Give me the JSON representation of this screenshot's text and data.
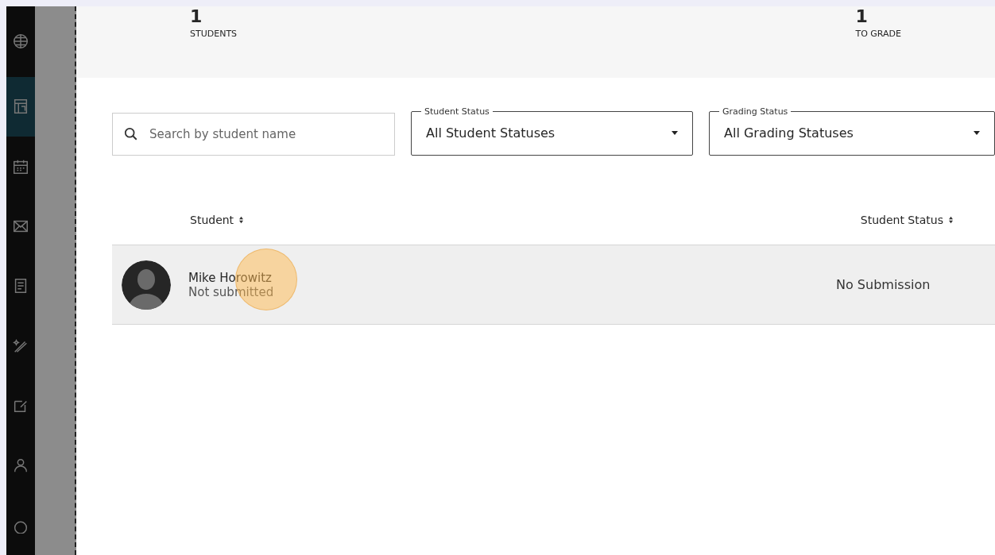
{
  "nav": [
    {
      "selected": false
    },
    {
      "selected": true
    },
    {
      "selected": false
    },
    {
      "selected": false
    },
    {
      "selected": false
    },
    {
      "selected": false
    },
    {
      "selected": false
    },
    {
      "selected": false
    },
    {
      "selected": false
    }
  ],
  "stats": [
    {
      "value": "1",
      "label": "STUDENTS"
    },
    {
      "value": "1",
      "label": "TO GRADE"
    }
  ],
  "search": {
    "placeholder": "Search by student name"
  },
  "filters": [
    {
      "label": "Student Status",
      "value": "All Student Statuses"
    },
    {
      "label": "Grading Status",
      "value": "All Grading Statuses"
    }
  ],
  "table": {
    "columns": [
      "Student",
      "Student Status"
    ],
    "rows": [
      {
        "name": "Mike Horowitz",
        "status_note": "Not submitted",
        "student_status": "No Submission"
      }
    ]
  }
}
